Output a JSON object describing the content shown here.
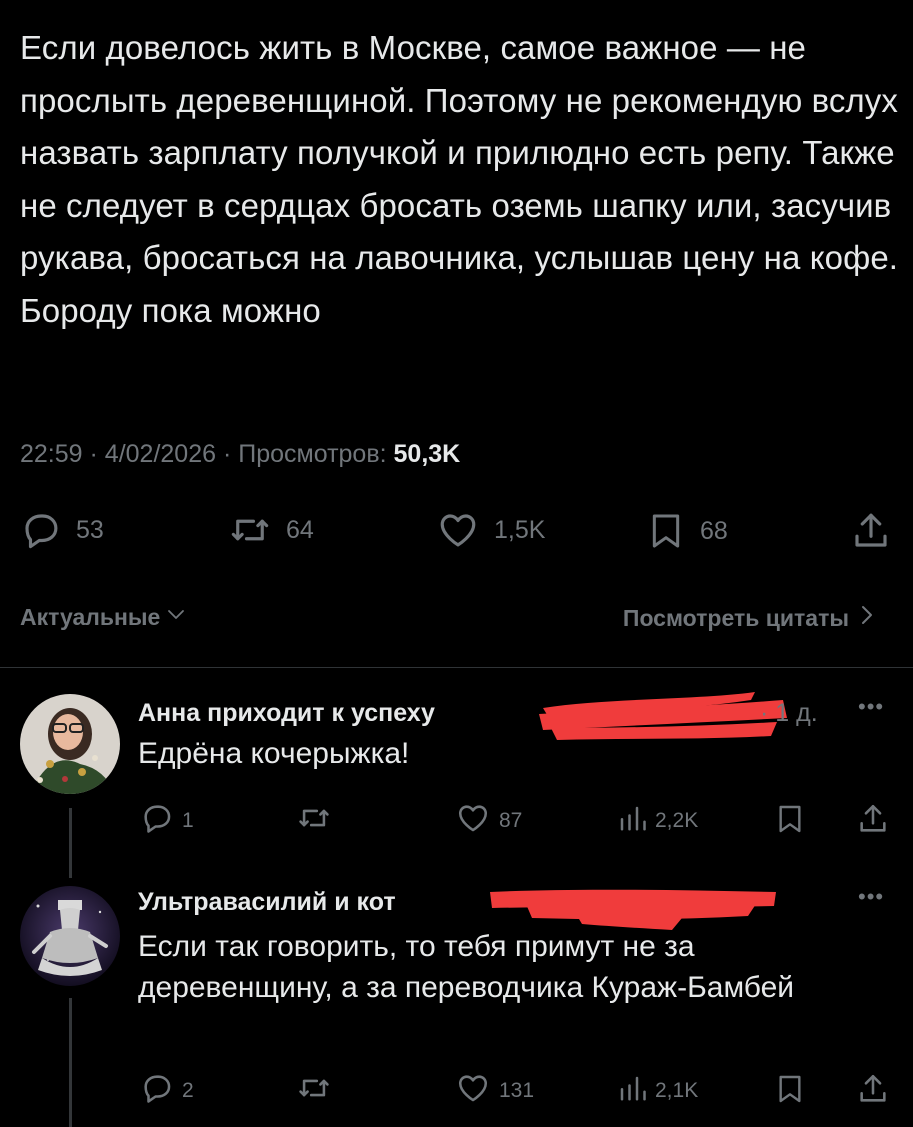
{
  "tweet": {
    "text": "Если довелось жить в Москве, самое важное — не прослыть деревенщиной. Поэтому не рекомендую вслух назвать зарплату получкой и прилюдно есть репу. Также не следует в сердцах бросать оземь шапку или, засучив рукава, бросаться на лавочника, услышав цену на кофе. Бороду пока можно",
    "time": "22:59",
    "date": "4/02/2026",
    "views_label": "Просмотров:",
    "views_value": "50,3K",
    "replies": "53",
    "reposts": "64",
    "likes": "1,5K",
    "bookmarks": "68"
  },
  "filter": {
    "sort_label": "Актуальные",
    "quotes_label": "Посмотреть цитаты"
  },
  "replies": [
    {
      "name": "Анна приходит к успеху",
      "time": "1 д.",
      "text": "Едрёна кочерыжка!",
      "replies": "1",
      "reposts": "",
      "likes": "87",
      "views": "2,2K"
    },
    {
      "name": "Ультравасилий и кот",
      "text": "Если так говорить, то тебя примут не за деревенщину, а за переводчика Кураж-Бамбей",
      "replies": "2",
      "reposts": "",
      "likes": "131",
      "views": "2,1K"
    }
  ],
  "colors": {
    "background": "#000000",
    "text": "#e7e9ea",
    "secondary": "#71767b",
    "redaction": "#f03c3c"
  },
  "icons": [
    "reply-icon",
    "repost-icon",
    "like-icon",
    "bookmark-icon",
    "share-icon",
    "views-icon",
    "more-icon",
    "chevron-down-icon",
    "chevron-right-icon"
  ]
}
